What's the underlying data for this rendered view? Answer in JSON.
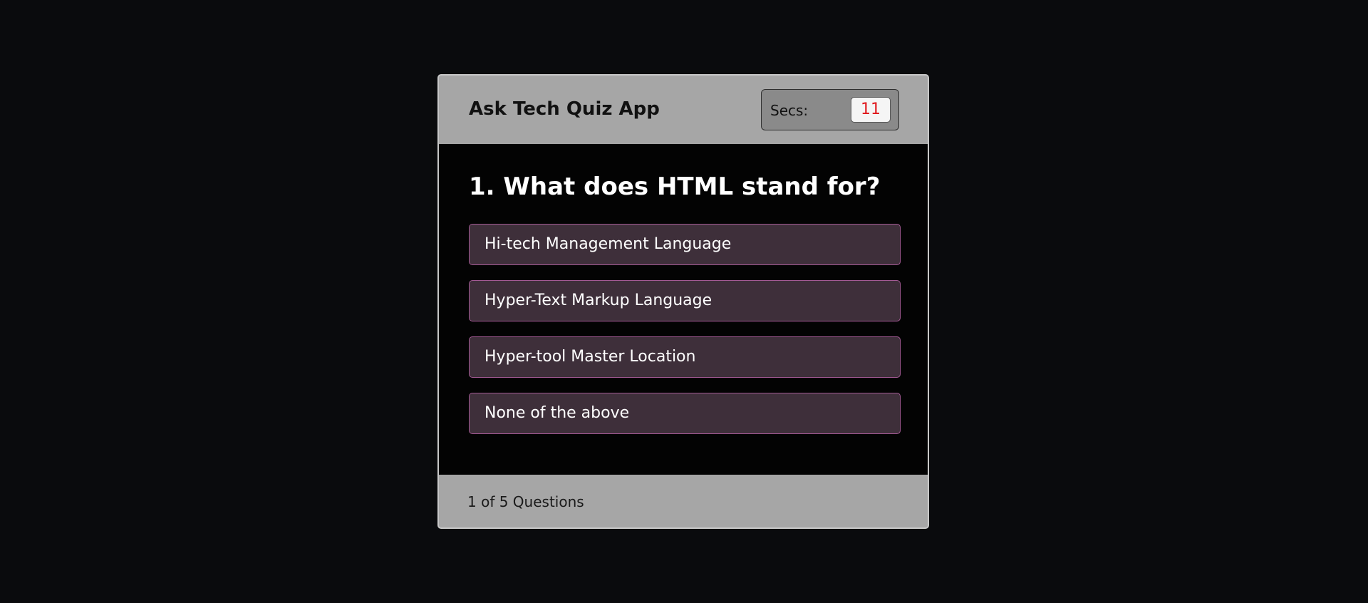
{
  "header": {
    "title": "Ask Tech Quiz App",
    "timer_label": "Secs:",
    "timer_value": "11"
  },
  "question": {
    "number_text": "1. What does HTML stand for?",
    "options": [
      "Hi-tech Management Language",
      "Hyper-Text Markup Language",
      "Hyper-tool Master Location",
      "None of the above"
    ]
  },
  "footer": {
    "counter": "1 of 5 Questions"
  },
  "colors": {
    "page_background": "#0a0b0d",
    "panel": "#a6a6a6",
    "body": "#030303",
    "option_background": "#3e2f3a",
    "option_border": "#a35a94",
    "timer_text": "#e0161b"
  }
}
